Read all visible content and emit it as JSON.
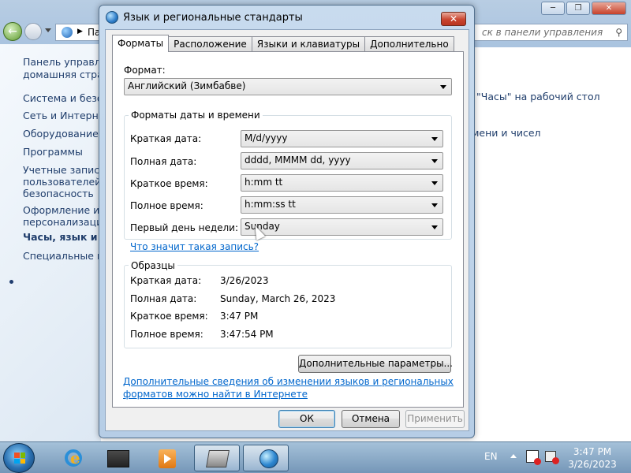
{
  "background": {
    "address_prefix": "Па",
    "search_placeholder": "ск в панели управления",
    "left_links": [
      "Панель управлен",
      "домашняя страни",
      "Система и безопа",
      "Сеть и Интернет",
      "Оборудование и з",
      "Программы",
      "Учетные записи",
      "пользователей и",
      "безопасность",
      "Оформление и",
      "персонализация",
      "Часы, язык и рег",
      "Специальные воз"
    ],
    "right_links": [
      "\"Часы\" на рабочий стол",
      "мени и чисел"
    ]
  },
  "dialog": {
    "title": "Язык и региональные стандарты",
    "close_label": "✕",
    "tabs": [
      "Форматы",
      "Расположение",
      "Языки и клавиатуры",
      "Дополнительно"
    ],
    "format_label": "Формат:",
    "format_value": "Английский (Зимбабве)",
    "datetime_group_title": "Форматы даты и времени",
    "fields": [
      {
        "label": "Краткая дата:",
        "value": "M/d/yyyy"
      },
      {
        "label": "Полная дата:",
        "value": "dddd, MMMM dd, yyyy"
      },
      {
        "label": "Краткое время:",
        "value": "h:mm tt"
      },
      {
        "label": "Полное время:",
        "value": "h:mm:ss tt"
      },
      {
        "label": "Первый день недели:",
        "value": "Sunday"
      }
    ],
    "notation_link": "Что значит такая запись?",
    "samples_group_title": "Образцы",
    "samples": [
      {
        "label": "Краткая дата:",
        "value": "3/26/2023"
      },
      {
        "label": "Полная дата:",
        "value": "Sunday, March 26, 2023"
      },
      {
        "label": "Краткое время:",
        "value": "3:47 PM"
      },
      {
        "label": "Полное время:",
        "value": "3:47:54 PM"
      }
    ],
    "advanced_button": "Дополнительные параметры...",
    "info_link_line1": "Дополнительные сведения об изменении языков и региональных",
    "info_link_line2": "форматов можно найти в Интернете",
    "ok_button": "ОК",
    "cancel_button": "Отмена",
    "apply_button": "Применить"
  },
  "taskbar": {
    "language": "EN",
    "time": "3:47 PM",
    "date": "3/26/2023"
  }
}
